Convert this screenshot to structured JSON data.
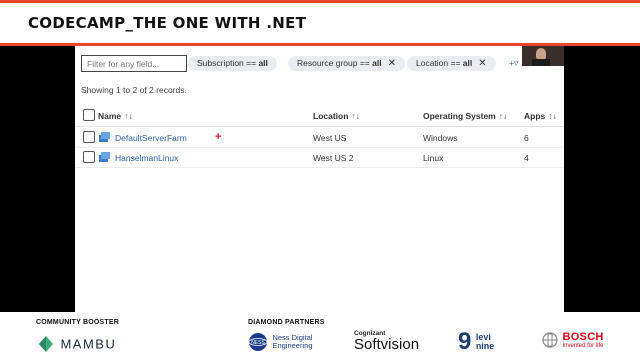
{
  "header": {
    "title": "CODECAMP_THE ONE WITH .NET"
  },
  "filters": {
    "search_placeholder": "Filter for any field...",
    "pills": [
      {
        "label": "Subscription == ",
        "value": "all"
      },
      {
        "label": "Resource group == ",
        "value": "all"
      },
      {
        "label": "Location == ",
        "value": "all"
      }
    ],
    "add_filter": "Add filter"
  },
  "records": {
    "summary": "Showing 1 to 2 of 2 records."
  },
  "table": {
    "columns": [
      "Name",
      "Location",
      "Operating System",
      "Apps"
    ],
    "rows": [
      {
        "name": "DefaultServerFarm",
        "location": "West US",
        "os": "Windows",
        "apps": "6"
      },
      {
        "name": "HanselmanLinux",
        "location": "West US 2",
        "os": "Linux",
        "apps": "4"
      }
    ]
  },
  "sponsors": {
    "community_label": "COMMUNITY BOOSTER",
    "diamond_label": "DIAMOND PARTNERS",
    "mambu": "MAMBU",
    "ness_line1": "Ness Digital",
    "ness_line2": "Engineering",
    "cognizant": "Cognizant",
    "softvision": "Softvision",
    "levi_line1": "levi",
    "levi_line2": "nine",
    "bosch": "BOSCH",
    "bosch_tag": "Invented for life"
  },
  "colors": {
    "accent": "#e8462b",
    "link": "#2c5fa0"
  }
}
